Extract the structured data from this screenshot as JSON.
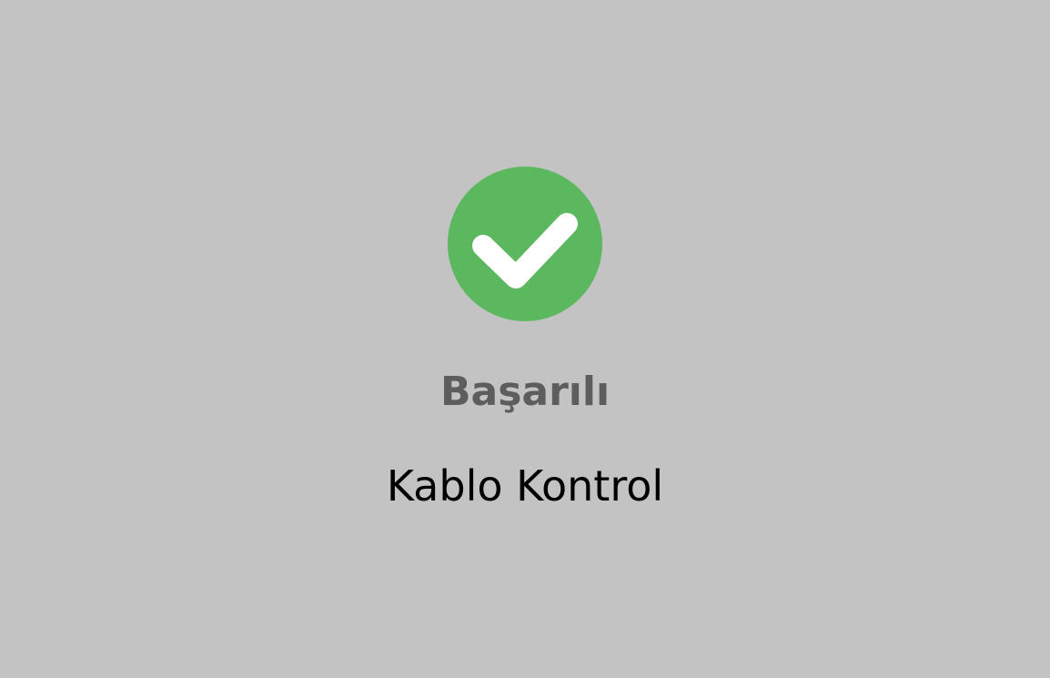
{
  "dialog": {
    "icon": "check-circle-icon",
    "title": "Başarılı",
    "message": "Kablo Kontrol"
  },
  "colors": {
    "background": "#c3c3c3",
    "icon_circle": "#5cb85f",
    "icon_check": "#ffffff",
    "title": "#5d5d5d",
    "message": "#000000"
  }
}
